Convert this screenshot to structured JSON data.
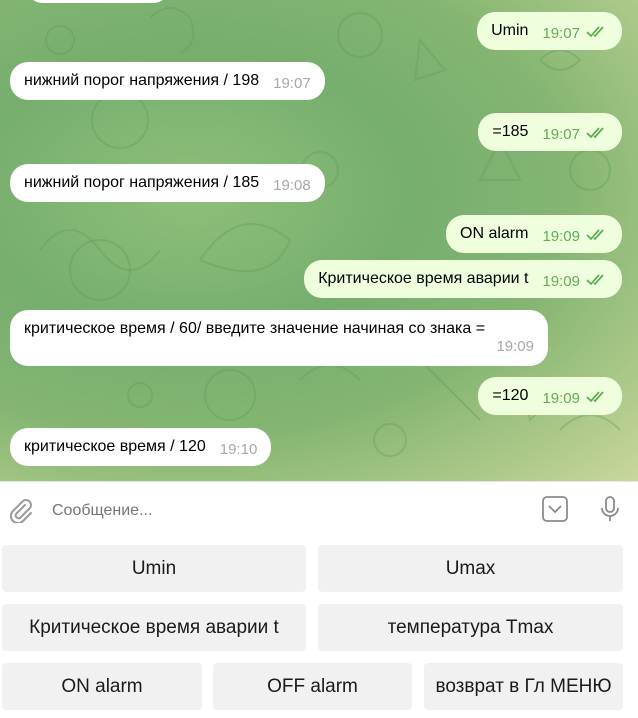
{
  "messages": [
    {
      "dir": "out",
      "text": "Umin",
      "time": "19:07",
      "read": true
    },
    {
      "dir": "in",
      "text": "нижний порог напряжения / 198",
      "time": "19:07"
    },
    {
      "dir": "out",
      "text": "=185",
      "time": "19:07",
      "read": true
    },
    {
      "dir": "in",
      "text": "нижний порог напряжения / 185",
      "time": "19:08"
    },
    {
      "dir": "out",
      "text": "ON alarm",
      "time": "19:09",
      "read": true
    },
    {
      "dir": "out",
      "text": "Критическое время аварии t",
      "time": "19:09",
      "read": true
    },
    {
      "dir": "in",
      "text": "критическое время / 60/ введите значение начиная со знака =",
      "time": "19:09"
    },
    {
      "dir": "out",
      "text": "=120",
      "time": "19:09",
      "read": true
    },
    {
      "dir": "in",
      "text": "критическое время / 120",
      "time": "19:10"
    }
  ],
  "input": {
    "placeholder": "Сообщение..."
  },
  "keyboard": {
    "rows": [
      [
        "Umin",
        "Umax"
      ],
      [
        "Критическое время аварии t",
        "температура Tmax"
      ],
      [
        "ON alarm",
        "OFF alarm",
        "возврат в Гл МЕНЮ"
      ]
    ]
  },
  "colors": {
    "incoming": "#ffffff",
    "outgoing": "#efffde",
    "tick": "#62ac55",
    "button": "#f1f1f1"
  }
}
